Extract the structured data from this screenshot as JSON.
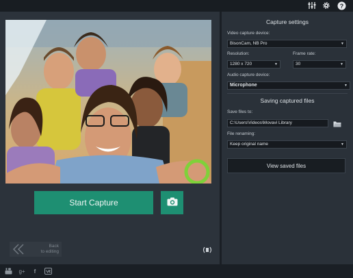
{
  "toolbar": {
    "icons": [
      "equalizer-icon",
      "gear-icon",
      "help-icon"
    ],
    "help_label": "?"
  },
  "main": {
    "start_capture_label": "Start Capture",
    "back_label": "Back\nto editing",
    "preview": "photo of a group of smiling friends taking a selfie outdoors"
  },
  "settings": {
    "capture_title": "Capture settings",
    "video_device_label": "Video capture device:",
    "video_device_value": "BisonCam, NB Pro",
    "resolution_label": "Resolution:",
    "resolution_value": "1280 x 720",
    "frame_rate_label": "Frame rate:",
    "frame_rate_value": "30",
    "audio_device_label": "Audio capture device:",
    "audio_device_value": "Microphone",
    "saving_title": "Saving captured files",
    "save_to_label": "Save files to:",
    "save_to_value": "C:\\Users\\Videos\\Movavi Library",
    "renaming_label": "File renaming:",
    "renaming_value": "Keep original name",
    "view_saved_label": "View saved files"
  },
  "social": {
    "icons": [
      "youtube-icon",
      "google-plus-icon",
      "facebook-icon",
      "vk-icon"
    ],
    "gplus_label": "g+",
    "facebook_label": "f"
  },
  "colors": {
    "accent": "#1e8f72",
    "panel": "#2a3139",
    "background": "#1f252c"
  }
}
